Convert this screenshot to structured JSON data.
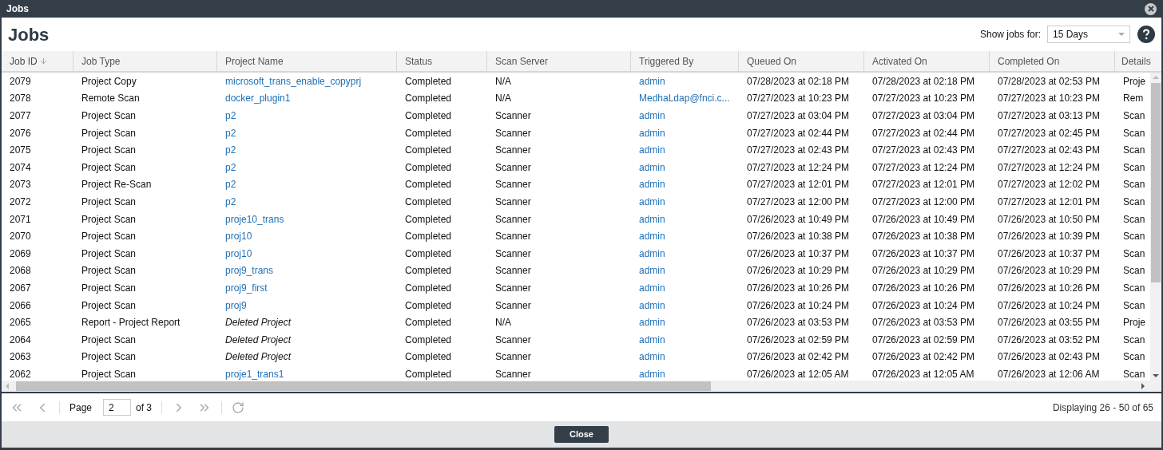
{
  "window": {
    "title": "Jobs"
  },
  "heading": "Jobs",
  "filter": {
    "label": "Show jobs for:",
    "value": "15 Days"
  },
  "table": {
    "columns": [
      {
        "label": "Job ID",
        "sorted": true
      },
      {
        "label": "Job Type",
        "sorted": false
      },
      {
        "label": "Project Name",
        "sorted": false
      },
      {
        "label": "Status",
        "sorted": false
      },
      {
        "label": "Scan Server",
        "sorted": false
      },
      {
        "label": "Triggered By",
        "sorted": false
      },
      {
        "label": "Queued On",
        "sorted": false
      },
      {
        "label": "Activated On",
        "sorted": false
      },
      {
        "label": "Completed On",
        "sorted": false
      },
      {
        "label": "Details",
        "sorted": false
      }
    ],
    "rows": [
      {
        "id": "2079",
        "type": "Project Copy",
        "project": "microsoft_trans_enable_copyprj",
        "deleted": false,
        "status": "Completed",
        "server": "N/A",
        "by": "admin",
        "queued": "07/28/2023 at 02:18 PM",
        "activated": "07/28/2023 at 02:18 PM",
        "completed": "07/28/2023 at 02:53 PM",
        "details": "Proje"
      },
      {
        "id": "2078",
        "type": "Remote Scan",
        "project": "docker_plugin1",
        "deleted": false,
        "status": "Completed",
        "server": "N/A",
        "by": "MedhaLdap@fnci.c...",
        "queued": "07/27/2023 at 10:23 PM",
        "activated": "07/27/2023 at 10:23 PM",
        "completed": "07/27/2023 at 10:23 PM",
        "details": "Rem"
      },
      {
        "id": "2077",
        "type": "Project Scan",
        "project": "p2",
        "deleted": false,
        "status": "Completed",
        "server": "Scanner",
        "by": "admin",
        "queued": "07/27/2023 at 03:04 PM",
        "activated": "07/27/2023 at 03:04 PM",
        "completed": "07/27/2023 at 03:13 PM",
        "details": "Scan"
      },
      {
        "id": "2076",
        "type": "Project Scan",
        "project": "p2",
        "deleted": false,
        "status": "Completed",
        "server": "Scanner",
        "by": "admin",
        "queued": "07/27/2023 at 02:44 PM",
        "activated": "07/27/2023 at 02:44 PM",
        "completed": "07/27/2023 at 02:45 PM",
        "details": "Scan"
      },
      {
        "id": "2075",
        "type": "Project Scan",
        "project": "p2",
        "deleted": false,
        "status": "Completed",
        "server": "Scanner",
        "by": "admin",
        "queued": "07/27/2023 at 02:43 PM",
        "activated": "07/27/2023 at 02:43 PM",
        "completed": "07/27/2023 at 02:43 PM",
        "details": "Scan"
      },
      {
        "id": "2074",
        "type": "Project Scan",
        "project": "p2",
        "deleted": false,
        "status": "Completed",
        "server": "Scanner",
        "by": "admin",
        "queued": "07/27/2023 at 12:24 PM",
        "activated": "07/27/2023 at 12:24 PM",
        "completed": "07/27/2023 at 12:24 PM",
        "details": "Scan"
      },
      {
        "id": "2073",
        "type": "Project Re-Scan",
        "project": "p2",
        "deleted": false,
        "status": "Completed",
        "server": "Scanner",
        "by": "admin",
        "queued": "07/27/2023 at 12:01 PM",
        "activated": "07/27/2023 at 12:01 PM",
        "completed": "07/27/2023 at 12:02 PM",
        "details": "Scan"
      },
      {
        "id": "2072",
        "type": "Project Scan",
        "project": "p2",
        "deleted": false,
        "status": "Completed",
        "server": "Scanner",
        "by": "admin",
        "queued": "07/27/2023 at 12:00 PM",
        "activated": "07/27/2023 at 12:00 PM",
        "completed": "07/27/2023 at 12:01 PM",
        "details": "Scan"
      },
      {
        "id": "2071",
        "type": "Project Scan",
        "project": "proje10_trans",
        "deleted": false,
        "status": "Completed",
        "server": "Scanner",
        "by": "admin",
        "queued": "07/26/2023 at 10:49 PM",
        "activated": "07/26/2023 at 10:49 PM",
        "completed": "07/26/2023 at 10:50 PM",
        "details": "Scan"
      },
      {
        "id": "2070",
        "type": "Project Scan",
        "project": "proj10",
        "deleted": false,
        "status": "Completed",
        "server": "Scanner",
        "by": "admin",
        "queued": "07/26/2023 at 10:38 PM",
        "activated": "07/26/2023 at 10:38 PM",
        "completed": "07/26/2023 at 10:39 PM",
        "details": "Scan"
      },
      {
        "id": "2069",
        "type": "Project Scan",
        "project": "proj10",
        "deleted": false,
        "status": "Completed",
        "server": "Scanner",
        "by": "admin",
        "queued": "07/26/2023 at 10:37 PM",
        "activated": "07/26/2023 at 10:37 PM",
        "completed": "07/26/2023 at 10:37 PM",
        "details": "Scan"
      },
      {
        "id": "2068",
        "type": "Project Scan",
        "project": "proj9_trans",
        "deleted": false,
        "status": "Completed",
        "server": "Scanner",
        "by": "admin",
        "queued": "07/26/2023 at 10:29 PM",
        "activated": "07/26/2023 at 10:29 PM",
        "completed": "07/26/2023 at 10:29 PM",
        "details": "Scan"
      },
      {
        "id": "2067",
        "type": "Project Scan",
        "project": "proj9_first",
        "deleted": false,
        "status": "Completed",
        "server": "Scanner",
        "by": "admin",
        "queued": "07/26/2023 at 10:26 PM",
        "activated": "07/26/2023 at 10:26 PM",
        "completed": "07/26/2023 at 10:26 PM",
        "details": "Scan"
      },
      {
        "id": "2066",
        "type": "Project Scan",
        "project": "proj9",
        "deleted": false,
        "status": "Completed",
        "server": "Scanner",
        "by": "admin",
        "queued": "07/26/2023 at 10:24 PM",
        "activated": "07/26/2023 at 10:24 PM",
        "completed": "07/26/2023 at 10:24 PM",
        "details": "Scan"
      },
      {
        "id": "2065",
        "type": "Report - Project Report",
        "project": "Deleted Project",
        "deleted": true,
        "status": "Completed",
        "server": "N/A",
        "by": "admin",
        "queued": "07/26/2023 at 03:53 PM",
        "activated": "07/26/2023 at 03:53 PM",
        "completed": "07/26/2023 at 03:55 PM",
        "details": "Proje"
      },
      {
        "id": "2064",
        "type": "Project Scan",
        "project": "Deleted Project",
        "deleted": true,
        "status": "Completed",
        "server": "Scanner",
        "by": "admin",
        "queued": "07/26/2023 at 02:59 PM",
        "activated": "07/26/2023 at 02:59 PM",
        "completed": "07/26/2023 at 03:52 PM",
        "details": "Scan"
      },
      {
        "id": "2063",
        "type": "Project Scan",
        "project": "Deleted Project",
        "deleted": true,
        "status": "Completed",
        "server": "Scanner",
        "by": "admin",
        "queued": "07/26/2023 at 02:42 PM",
        "activated": "07/26/2023 at 02:42 PM",
        "completed": "07/26/2023 at 02:43 PM",
        "details": "Scan"
      },
      {
        "id": "2062",
        "type": "Project Scan",
        "project": "proje1_trans1",
        "deleted": false,
        "status": "Completed",
        "server": "Scanner",
        "by": "admin",
        "queued": "07/26/2023 at 12:05 AM",
        "activated": "07/26/2023 at 12:05 AM",
        "completed": "07/26/2023 at 12:06 AM",
        "details": "Scan"
      }
    ]
  },
  "pager": {
    "page_label": "Page",
    "page": "2",
    "of": "of 3",
    "display": "Displaying 26 - 50 of 65"
  },
  "close_button": "Close"
}
